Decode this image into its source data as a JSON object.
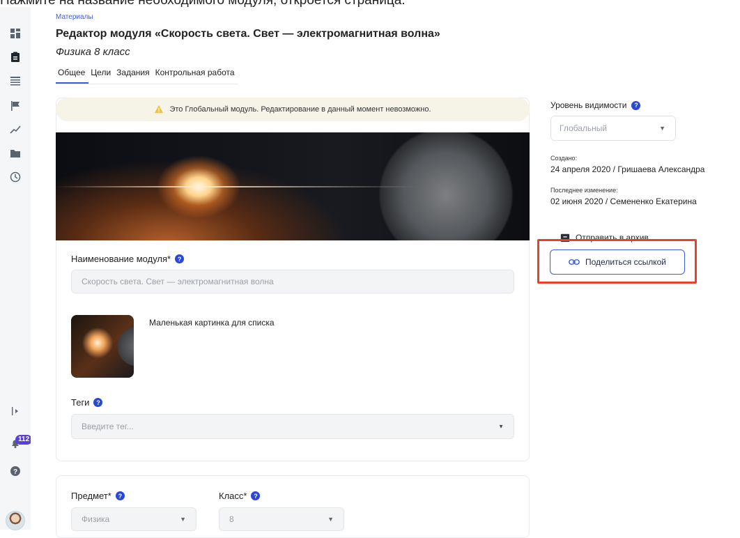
{
  "caption": "Нажмите на название необходимого модуля, откроется страница:",
  "breadcrumb": "Материалы",
  "page": {
    "title": "Редактор модуля «Скорость света. Свет — электромагнитная волна»",
    "subtitle": "Физика 8 класс"
  },
  "tabs": [
    {
      "label": "Общее",
      "active": true
    },
    {
      "label": "Цели",
      "active": false
    },
    {
      "label": "Задания",
      "active": false
    },
    {
      "label": "Контрольная работа",
      "active": false
    }
  ],
  "warning": "Это Глобальный модуль. Редактирование в данный момент невозможно.",
  "form": {
    "name_label": "Наименование модуля*",
    "name_value": "Скорость света. Свет — электромагнитная волна",
    "thumb_label": "Маленькая картинка для списка",
    "tags_label": "Теги",
    "tags_placeholder": "Введите тег...",
    "subject_label": "Предмет*",
    "subject_value": "Физика",
    "grade_label": "Класс*",
    "grade_value": "8"
  },
  "side": {
    "visibility_label": "Уровень видимости",
    "visibility_value": "Глобальный",
    "created_label": "Создано:",
    "created_value": "24 апреля 2020 / Гришаева Александра",
    "modified_label": "Последнее изменение:",
    "modified_value": "02 июня 2020 / Семененко Екатерина",
    "archive_label": "Отправить в архив",
    "share_label": "Поделиться ссылкой"
  },
  "notifications_count": "112",
  "colors": {
    "accent": "#3d5bd9",
    "highlight": "#e8402a",
    "badge": "#5b3fd6"
  }
}
